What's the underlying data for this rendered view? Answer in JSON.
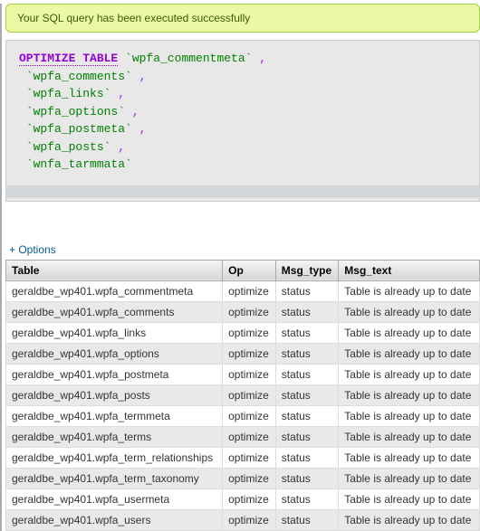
{
  "banner": {
    "message": "Your SQL query has been executed successfully"
  },
  "sql": {
    "keyword": "OPTIMIZE TABLE",
    "lines": [
      " `wpfa_commentmeta` ,",
      " `wpfa_comments` ,",
      " `wpfa_links` ,",
      " `wpfa_options` ,",
      " `wpfa_postmeta` ,",
      " `wpfa_posts` ,",
      " `wnfa_tarmmata` "
    ]
  },
  "options_label": "+ Options",
  "columns": [
    "Table",
    "Op",
    "Msg_type",
    "Msg_text"
  ],
  "rows": [
    [
      "geraldbe_wp401.wpfa_commentmeta",
      "optimize",
      "status",
      "Table is already up to date"
    ],
    [
      "geraldbe_wp401.wpfa_comments",
      "optimize",
      "status",
      "Table is already up to date"
    ],
    [
      "geraldbe_wp401.wpfa_links",
      "optimize",
      "status",
      "Table is already up to date"
    ],
    [
      "geraldbe_wp401.wpfa_options",
      "optimize",
      "status",
      "Table is already up to date"
    ],
    [
      "geraldbe_wp401.wpfa_postmeta",
      "optimize",
      "status",
      "Table is already up to date"
    ],
    [
      "geraldbe_wp401.wpfa_posts",
      "optimize",
      "status",
      "Table is already up to date"
    ],
    [
      "geraldbe_wp401.wpfa_termmeta",
      "optimize",
      "status",
      "Table is already up to date"
    ],
    [
      "geraldbe_wp401.wpfa_terms",
      "optimize",
      "status",
      "Table is already up to date"
    ],
    [
      "geraldbe_wp401.wpfa_term_relationships",
      "optimize",
      "status",
      "Table is already up to date"
    ],
    [
      "geraldbe_wp401.wpfa_term_taxonomy",
      "optimize",
      "status",
      "Table is already up to date"
    ],
    [
      "geraldbe_wp401.wpfa_usermeta",
      "optimize",
      "status",
      "Table is already up to date"
    ],
    [
      "geraldbe_wp401.wpfa_users",
      "optimize",
      "status",
      "Table is already up to date"
    ]
  ]
}
